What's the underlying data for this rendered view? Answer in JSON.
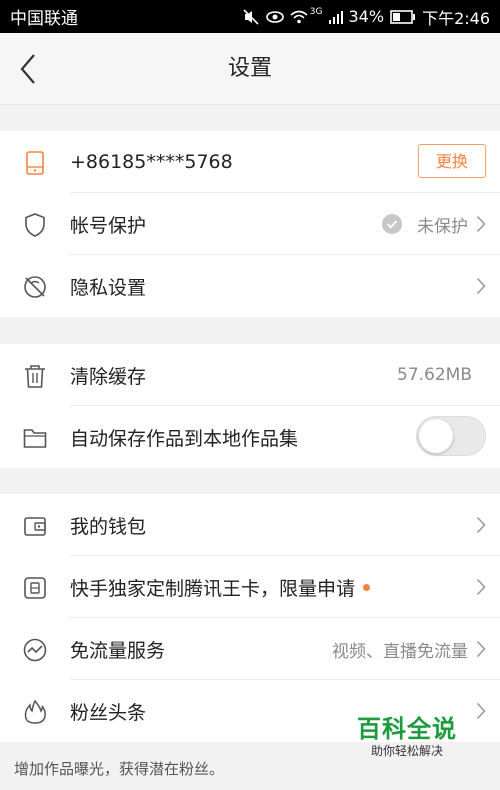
{
  "status_bar": {
    "carrier": "中国联通",
    "network_type": "3G",
    "battery": "34%",
    "time": "下午2:46"
  },
  "header": {
    "title": "设置"
  },
  "account": {
    "phone": "+86185****5768",
    "change_label": "更换",
    "protection_label": "帐号保护",
    "protection_status": "未保护",
    "privacy_label": "隐私设置"
  },
  "storage": {
    "clear_cache_label": "清除缓存",
    "cache_size": "57.62MB",
    "auto_save_label": "自动保存作品到本地作品集",
    "auto_save_on": false
  },
  "services": {
    "wallet_label": "我的钱包",
    "wangka_label": "快手独家定制腾讯王卡，限量申请",
    "free_traffic_label": "免流量服务",
    "free_traffic_value": "视频、直播免流量",
    "fans_headline_label": "粉丝头条"
  },
  "footer": {
    "promo_text": "增加作品曝光，获得潜在粉丝。"
  },
  "watermark": {
    "title": "百科全说",
    "subtitle": "助你轻松解决"
  },
  "colors": {
    "accent": "#f3833f",
    "watermark_green": "#1c9b3c"
  }
}
